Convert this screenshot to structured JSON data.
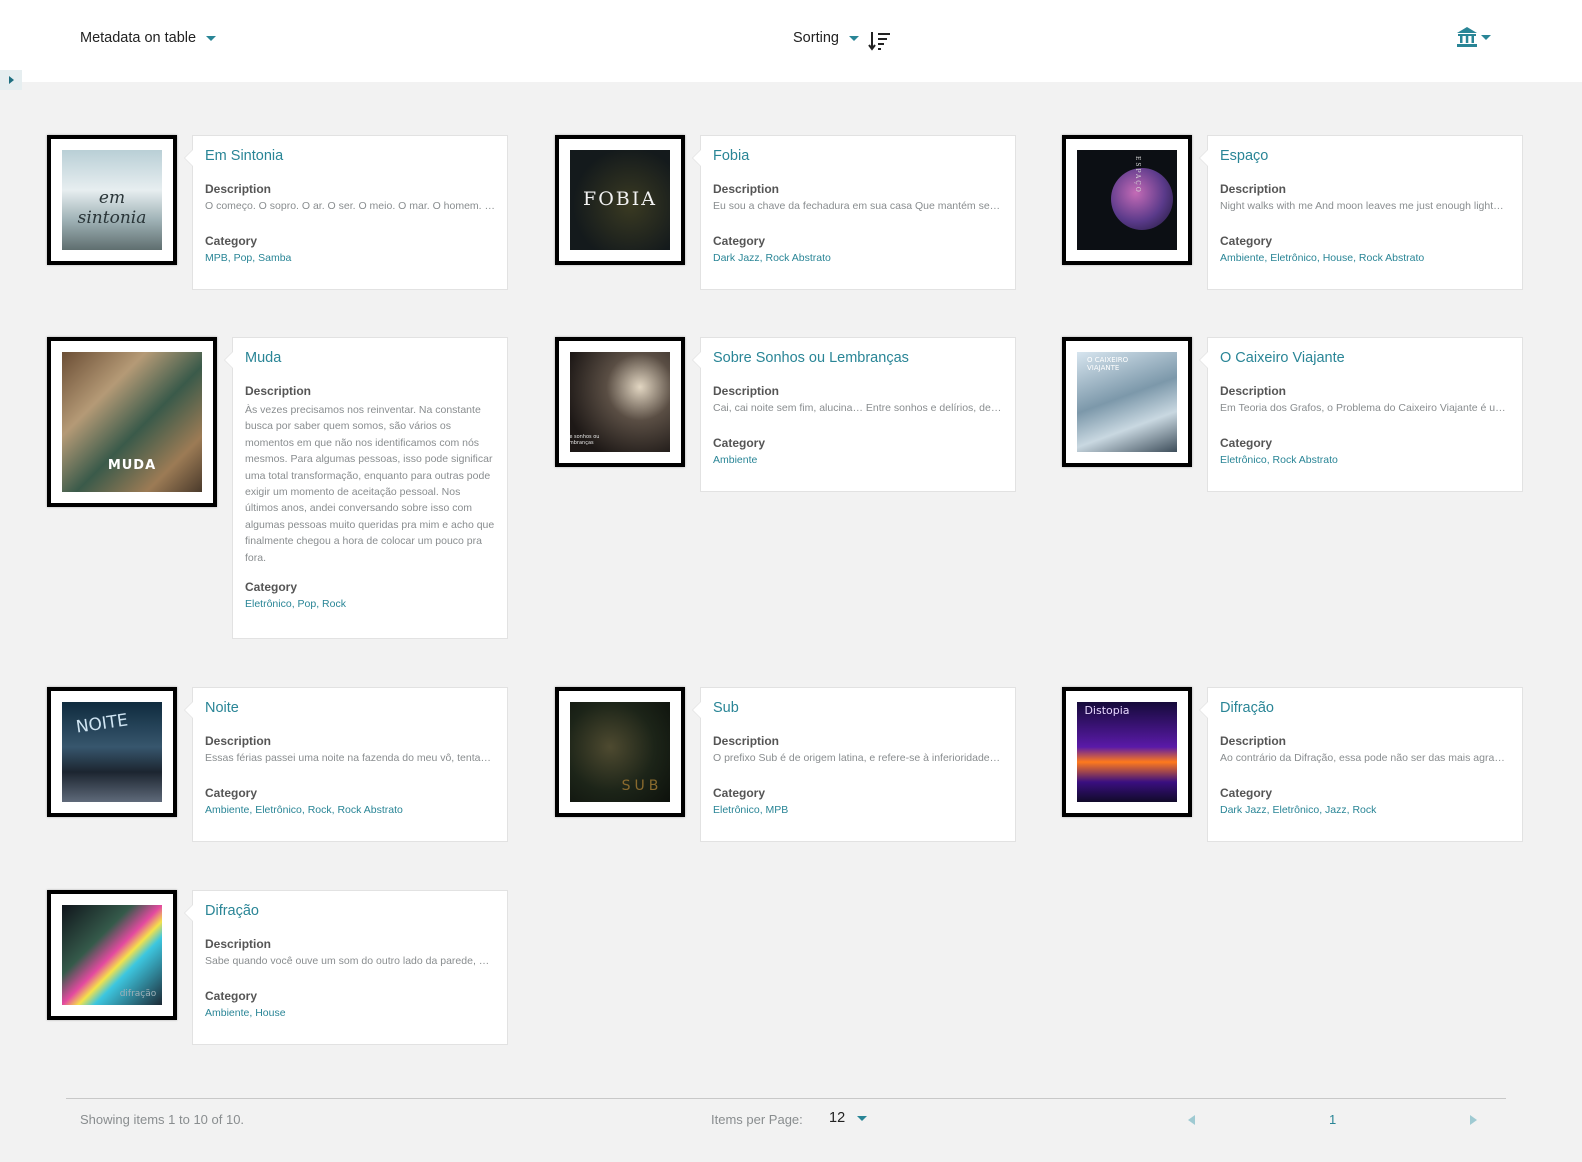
{
  "toolbar": {
    "metadata_label": "Metadata on table",
    "sorting_label": "Sorting",
    "colors": {
      "accent": "#298596",
      "text_muted": "#898d8f",
      "background": "#f2f2f2"
    }
  },
  "labels": {
    "description": "Description",
    "category": "Category"
  },
  "items": [
    {
      "title": "Em Sintonia",
      "description": "O começo. O sopro. O ar. O ser. O meio. O mar. O homem. …",
      "category": "MPB, Pop, Samba",
      "cover_text": "em sintonia"
    },
    {
      "title": "Fobia",
      "description": "Eu sou a chave da fechadura em sua casa Que mantém se…",
      "category": "Dark Jazz, Rock Abstrato",
      "cover_text": "FOBIA"
    },
    {
      "title": "Espaço",
      "description": "Night walks with me And moon leaves me just enough light…",
      "category": "Ambiente, Eletrônico, House, Rock Abstrato",
      "cover_text": "ESPAÇO"
    },
    {
      "title": "Muda",
      "description": "Às vezes precisamos nos reinventar. Na constante busca por saber quem somos, são vários os momentos em que não nos identificamos com nós mesmos. Para algumas pessoas, isso pode significar uma total transformação, enquanto para outras pode exigir um momento de aceitação pessoal. Nos últimos anos, andei conversando sobre isso com algumas pessoas muito queridas pra mim e acho que finalmente chegou a hora de colocar um pouco pra fora.",
      "category": "Eletrônico, Pop, Rock",
      "cover_text": "MUDA"
    },
    {
      "title": "Sobre Sonhos ou Lembranças",
      "description": "Cai, cai noite sem fim, alucina… Entre sonhos e delírios, des…",
      "category": "Ambiente",
      "cover_text": "sobre sonhos ou lembranças"
    },
    {
      "title": "O Caixeiro Viajante",
      "description": "Em Teoria dos Grafos, o Problema do Caixeiro Viajante é u…",
      "category": "Eletrônico, Rock Abstrato",
      "cover_text": "O CAIXEIRO VIAJANTE"
    },
    {
      "title": "Noite",
      "description": "Essas férias passei uma noite na fazenda do meu vô, tenta…",
      "category": "Ambiente, Eletrônico, Rock, Rock Abstrato",
      "cover_text": "NOITE"
    },
    {
      "title": "Sub",
      "description": "O prefixo Sub é de origem latina, e refere-se à inferioridade.…",
      "category": "Eletrônico, MPB",
      "cover_text": "SUB"
    },
    {
      "title": "Difração",
      "description": "Ao contrário da Difração, essa pode não ser das mais agra…",
      "category": "Dark Jazz, Eletrônico, Jazz, Rock",
      "cover_text": "Distopia"
    },
    {
      "title": "Difração",
      "description": "Sabe quando você ouve um som do outro lado da parede, …",
      "category": "Ambiente, House",
      "cover_text": "difração"
    }
  ],
  "footer": {
    "showing": "Showing items 1 to 10 of 10.",
    "items_per_page_label": "Items per Page:",
    "items_per_page_value": "12",
    "current_page": "1"
  },
  "icons": [
    "chevron-down-icon",
    "sort-order-icon",
    "institution-icon",
    "sidebar-expand-icon",
    "page-prev-icon",
    "page-next-icon"
  ]
}
